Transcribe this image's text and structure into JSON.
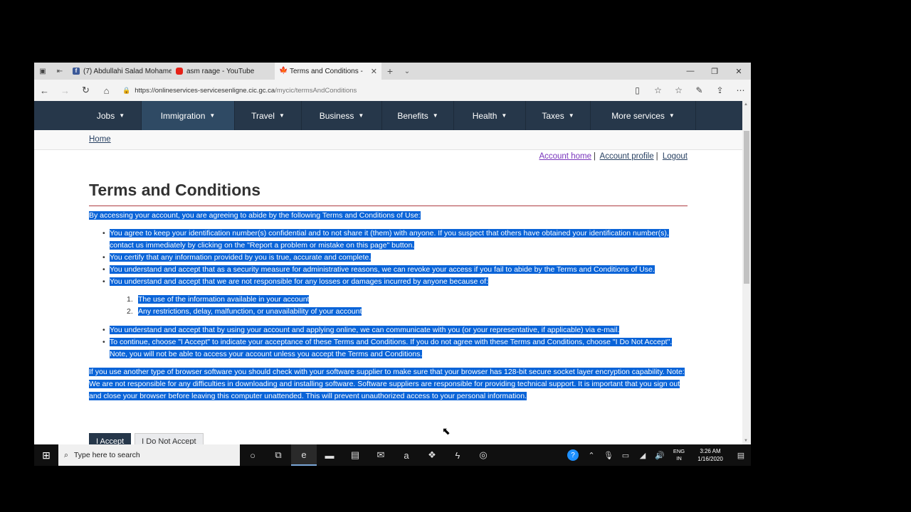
{
  "browser": {
    "tabs": [
      {
        "title": "(7) Abdullahi Salad Mohame",
        "icon": "facebook-icon"
      },
      {
        "title": "asm raage - YouTube",
        "icon": "youtube-icon"
      },
      {
        "title": "Terms and Conditions -",
        "icon": "maple-leaf-icon"
      }
    ],
    "url_host": "https://onlineservices-servicesenligne.cic.gc.ca",
    "url_path": "/mycic/termsAndConditions"
  },
  "menu": {
    "items": [
      "Jobs",
      "Immigration",
      "Travel",
      "Business",
      "Benefits",
      "Health",
      "Taxes",
      "More services"
    ]
  },
  "breadcrumb": {
    "home": "Home"
  },
  "account_links": {
    "home": "Account home",
    "profile": "Account profile",
    "logout": "Logout",
    "sep": "|"
  },
  "page": {
    "title": "Terms and Conditions",
    "intro": "By accessing your account, you are agreeing to abide by the following Terms and Conditions of Use:",
    "bullets_a": [
      "You agree to keep your identification number(s) confidential and to not share it (them) with anyone. If you suspect that others have obtained your identification number(s), contact us immediately by clicking on the \"Report a problem or mistake on this page\" button.",
      "You certify that any information provided by you is true, accurate and complete.",
      "You understand and accept that as a security measure for administrative reasons, we can revoke your access if you fail to abide by the Terms and Conditions of Use.",
      "You understand and accept that we are not responsible for any losses or damages incurred by anyone because of:"
    ],
    "numbered": [
      {
        "n": "1.",
        "text": "The use of the information available in your account"
      },
      {
        "n": "2.",
        "text": "Any restrictions, delay, malfunction, or unavailability of your account"
      }
    ],
    "bullets_b": [
      "You understand and accept that by using your account and applying online, we can communicate with you (or your representative, if applicable) via e-mail.",
      "To continue, choose \"I Accept\" to indicate your acceptance of these Terms and Conditions. If you do not agree with these Terms and Conditions, choose \"I Do Not Accept\". Note, you will not be able to access your account unless you accept the Terms and Conditions."
    ],
    "paragraph": "If you use another type of browser software you should check with your software supplier to make sure that your browser has 128-bit secure socket layer encryption capability. Note: We are not responsible for any difficulties in downloading and installing software. Software suppliers are responsible for providing technical support. It is important that you sign out and close your browser before leaving this computer unattended. This will prevent unauthorized access to your personal information.",
    "accept_label": "I Accept",
    "decline_label": "I Do Not Accept"
  },
  "taskbar": {
    "search_placeholder": "Type here to search",
    "lang_line1": "ENG",
    "lang_line2": "IN",
    "time": "3:26 AM",
    "date": "1/16/2020"
  },
  "colors": {
    "gc_nav": "#26374a",
    "selection": "#0a64d8",
    "title_rule": "#af3c43"
  }
}
